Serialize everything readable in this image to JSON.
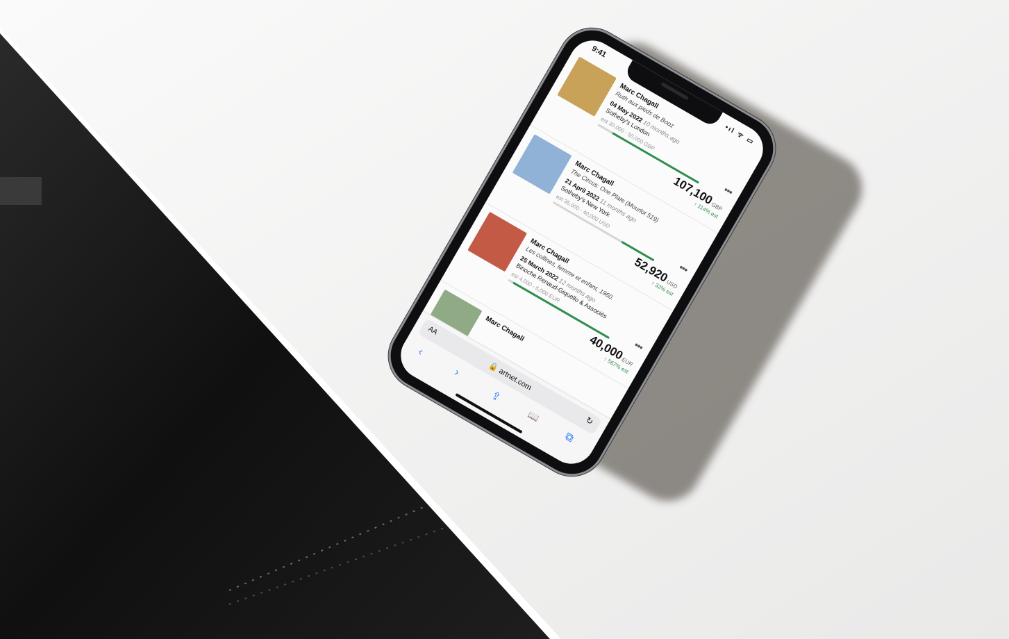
{
  "status": {
    "time": "9:41",
    "icons": "•ıl ᯤ ▭"
  },
  "lots": [
    {
      "artist": "Marc Chagall",
      "title": "Ruth aux pieds de Booz",
      "date": "04 May 2022",
      "ago": "10 months ago",
      "house": "Sotheby's London",
      "estimate": "est 30,000 - 50,000 GBP",
      "price": "107,100",
      "currency": "GBP",
      "delta": "↑ 114% est",
      "progress": 0.86,
      "thumb_color": "#c9a25a"
    },
    {
      "artist": "Marc Chagall",
      "title": "The Circus: One Plate (Mourlot 519)",
      "date": "21 April 2022",
      "ago": "11 months ago",
      "house": "Sotheby's New York",
      "estimate": "est 35,000 - 40,000 USD",
      "price": "52,920",
      "currency": "USD",
      "delta": "↑ 32% est",
      "progress": 0.32,
      "thumb_color": "#8fb2d6"
    },
    {
      "artist": "Marc Chagall",
      "title": "Les collines, femme et enfant, 1960.",
      "date": "25 March 2022",
      "ago": "12 months ago",
      "house": "Binoche Renaud-Giquello & Associés",
      "estimate": "est 4,000 - 6,000 EUR",
      "price": "40,000",
      "currency": "EUR",
      "delta": "↑ 567% est",
      "progress": 0.95,
      "thumb_color": "#c25a45"
    },
    {
      "artist": "Marc Chagall",
      "title": "",
      "date": "",
      "ago": "",
      "house": "",
      "estimate": "",
      "price": "",
      "currency": "",
      "delta": "",
      "progress": 0,
      "thumb_color": "#8faa84"
    }
  ],
  "browser": {
    "aa": "AA",
    "url": "🔒 artnet.com",
    "reload": "↻",
    "back": "‹",
    "forward": "›",
    "share": "⇪",
    "bookmarks": "📖",
    "tabs": "⧉"
  },
  "scene_colors": {
    "table": "#efefee",
    "chair": "#141414",
    "accent_green": "#2f8f4e"
  }
}
